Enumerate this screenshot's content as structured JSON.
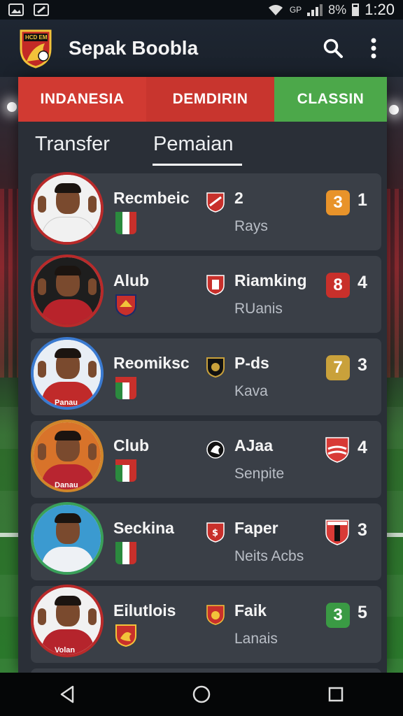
{
  "status_bar": {
    "network": "GP",
    "battery": "8%",
    "time": "1:20"
  },
  "app": {
    "title": "Sepak Boobla",
    "logo_text": "HCD EM"
  },
  "segments": [
    {
      "label": "INDANESIA",
      "color": "#d13a32"
    },
    {
      "label": "DEMDIRIN",
      "color": "#c8352e"
    },
    {
      "label": "CLASSIN",
      "color": "#4ca84a"
    }
  ],
  "tabs": [
    {
      "label": "Transfer"
    },
    {
      "label": "Pemaian",
      "active": true
    }
  ],
  "players": [
    {
      "name": "Recmbeic",
      "club": "2",
      "sub": "Rays",
      "badge": "3",
      "badge_color": "#e8932a",
      "score": "1",
      "ring_color": "#b92a2a",
      "avatar_bg": "#f1f1f1",
      "shirt": "#f1f1f1",
      "shirt_text": ""
    },
    {
      "name": "Alub",
      "club": "Riamking",
      "sub": "RUanis",
      "badge": "8",
      "badge_color": "#c8302b",
      "score": "4",
      "ring_color": "#b92a2a",
      "avatar_bg": "#1e1e1e",
      "shirt": "#b8232b",
      "shirt_text": ""
    },
    {
      "name": "Reomiksc",
      "club": "P-ds",
      "sub": "Kava",
      "badge": "7",
      "badge_color": "#c9a13b",
      "score": "3",
      "ring_color": "#3a7ad0",
      "avatar_bg": "#e8eef5",
      "shirt": "#c02a2a",
      "shirt_text": "Panau"
    },
    {
      "name": "Club",
      "club": "AJaa",
      "sub": "Senpite",
      "badge": "",
      "badge_color": "#d83a36",
      "score": "4",
      "ring_color": "#d0862a",
      "avatar_bg": "#d8732a",
      "shirt": "#b82530",
      "shirt_text": "Danau"
    },
    {
      "name": "Seckina",
      "club": "Faper",
      "sub": "Neits Acbs",
      "badge": "",
      "badge_color": "#d83a36",
      "score": "3",
      "ring_color": "#3aa05a",
      "avatar_bg": "#3b9ad0",
      "shirt": "#eef1f5",
      "shirt_text": ""
    },
    {
      "name": "Eilutlois",
      "club": "Faik",
      "sub": "Lanais",
      "badge": "3",
      "badge_color": "#3a9a44",
      "score": "5",
      "ring_color": "#b92a2a",
      "avatar_bg": "#f1f1f1",
      "shirt": "#b5242c",
      "shirt_text": "Volan"
    }
  ],
  "colors": {
    "app_bar": "#1e2632",
    "panel": "#2a2f37",
    "card": "#3a3f47"
  }
}
